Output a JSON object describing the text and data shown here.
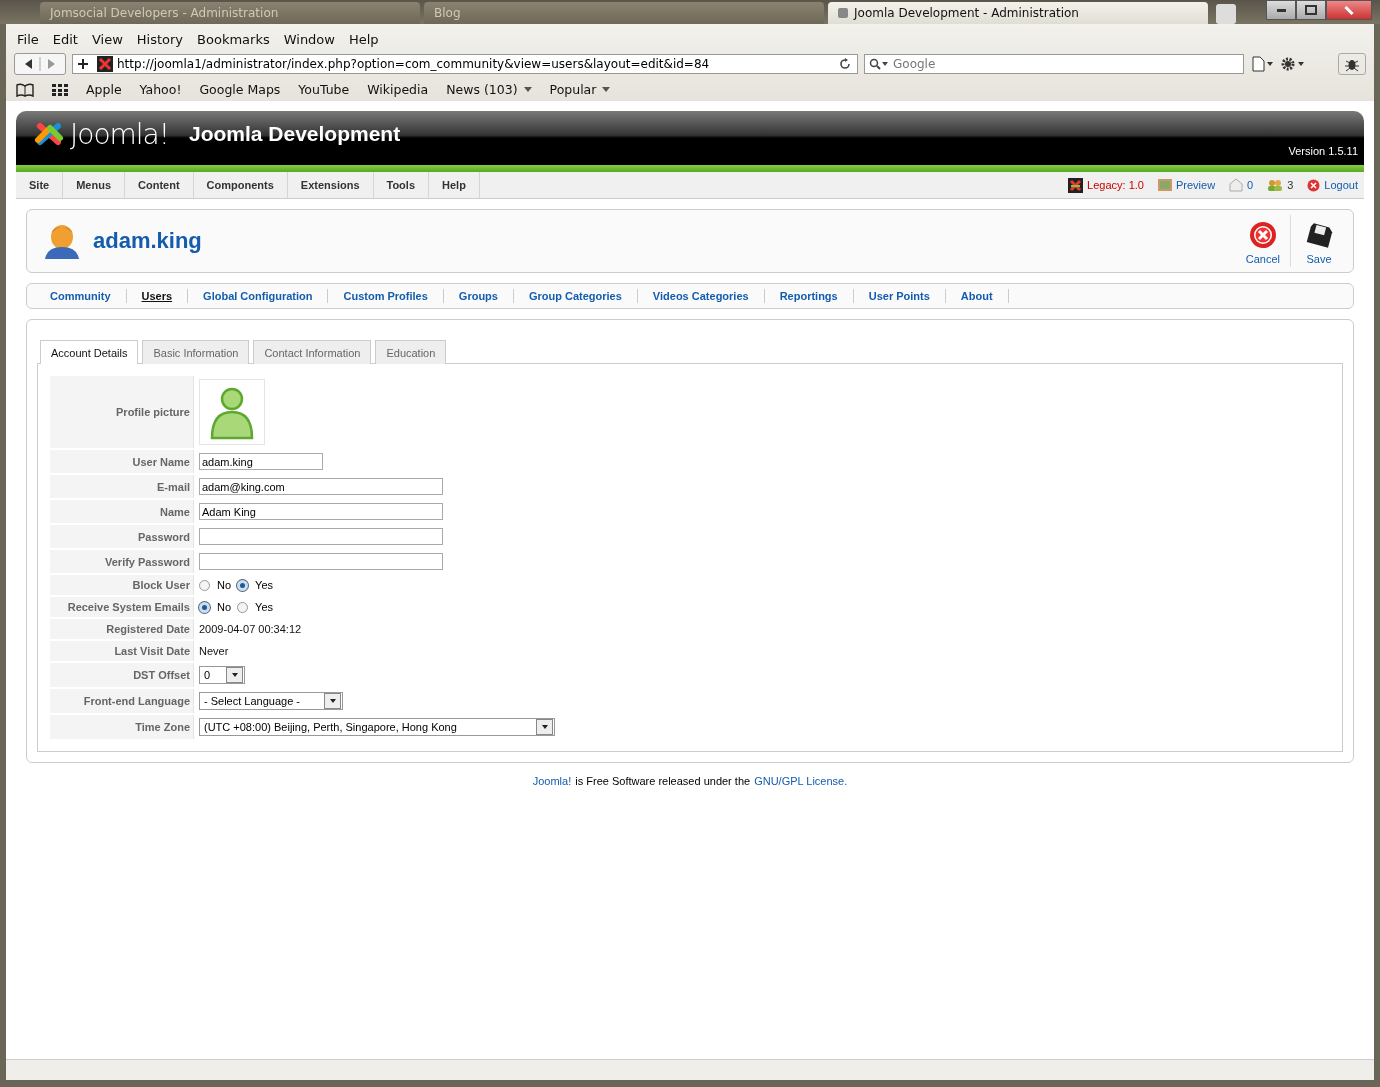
{
  "browser": {
    "tabs": [
      {
        "label": "Jomsocial Developers - Administration",
        "selected": false
      },
      {
        "label": "Blog",
        "selected": false
      },
      {
        "label": "Joomla Development - Administration",
        "selected": true
      }
    ],
    "menu": [
      "File",
      "Edit",
      "View",
      "History",
      "Bookmarks",
      "Window",
      "Help"
    ],
    "address": "http://joomla1/administrator/index.php?option=com_community&view=users&layout=edit&id=84",
    "search": {
      "placeholder": "Google"
    },
    "bookmarks": [
      {
        "label": "Apple",
        "kind": "link"
      },
      {
        "label": "Yahoo!",
        "kind": "link"
      },
      {
        "label": "Google Maps",
        "kind": "link"
      },
      {
        "label": "YouTube",
        "kind": "link"
      },
      {
        "label": "Wikipedia",
        "kind": "link"
      },
      {
        "label": "News (103)",
        "kind": "menu"
      },
      {
        "label": "Popular",
        "kind": "menu"
      }
    ]
  },
  "header": {
    "logo": "Joomla!",
    "site_name": "Joomla Development",
    "version": "Version 1.5.11"
  },
  "admin_menu": [
    "Site",
    "Menus",
    "Content",
    "Components",
    "Extensions",
    "Tools",
    "Help"
  ],
  "status": {
    "legacy": "Legacy: 1.0",
    "preview": "Preview",
    "messages": "0",
    "users": "3",
    "logout": "Logout"
  },
  "toolbar": {
    "title": "adam.king",
    "buttons": [
      {
        "label": "Cancel",
        "kind": "cancel"
      },
      {
        "label": "Save",
        "kind": "save"
      }
    ]
  },
  "submenu": [
    {
      "label": "Community",
      "selected": false
    },
    {
      "label": "Users",
      "selected": true
    },
    {
      "label": "Global Configuration",
      "selected": false
    },
    {
      "label": "Custom Profiles",
      "selected": false
    },
    {
      "label": "Groups",
      "selected": false
    },
    {
      "label": "Group Categories",
      "selected": false
    },
    {
      "label": "Videos Categories",
      "selected": false
    },
    {
      "label": "Reportings",
      "selected": false
    },
    {
      "label": "User Points",
      "selected": false
    },
    {
      "label": "About",
      "selected": false
    }
  ],
  "form_tabs": [
    {
      "label": "Account Details",
      "selected": true
    },
    {
      "label": "Basic Information",
      "selected": false
    },
    {
      "label": "Contact Information",
      "selected": false
    },
    {
      "label": "Education",
      "selected": false
    }
  ],
  "fields": [
    {
      "label": "Profile picture",
      "kind": "avatar"
    },
    {
      "label": "User Name",
      "kind": "text",
      "value": "adam.king"
    },
    {
      "label": "E-mail",
      "kind": "text",
      "value": "adam@king.com"
    },
    {
      "label": "Name",
      "kind": "text",
      "value": "Adam King"
    },
    {
      "label": "Password",
      "kind": "text"
    },
    {
      "label": "Verify Password",
      "kind": "text"
    },
    {
      "label": "Block User",
      "kind": "radio",
      "options": [
        {
          "label": "No",
          "selected": false
        },
        {
          "label": "Yes",
          "selected": true
        }
      ]
    },
    {
      "label": "Receive System Emails",
      "kind": "radio",
      "options": [
        {
          "label": "No",
          "selected": true
        },
        {
          "label": "Yes",
          "selected": false
        }
      ]
    },
    {
      "label": "Registered Date",
      "kind": "static",
      "value": "2009-04-07 00:34:12"
    },
    {
      "label": "Last Visit Date",
      "kind": "static",
      "value": "Never"
    },
    {
      "label": "DST Offset",
      "kind": "select",
      "value": "0"
    },
    {
      "label": "Front-end Language",
      "kind": "select",
      "value": "- Select Language -"
    },
    {
      "label": "Time Zone",
      "kind": "select",
      "value": "(UTC +08:00) Beijing, Perth, Singapore, Hong Kong"
    }
  ],
  "footer": [
    {
      "text": "Joomla!",
      "kind": "link"
    },
    {
      "text": "is Free Software released under the",
      "kind": "text"
    },
    {
      "text": "GNU/GPL License.",
      "kind": "link"
    }
  ]
}
